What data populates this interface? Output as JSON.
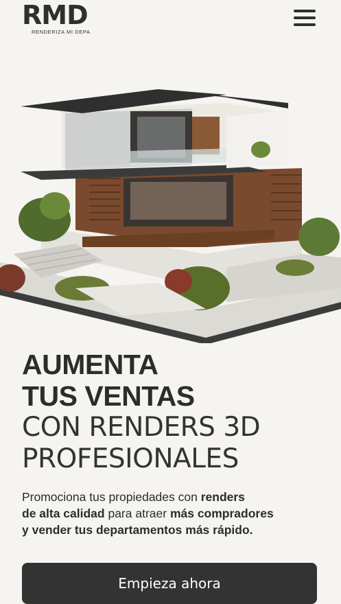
{
  "header": {
    "logo_mark": "RMD",
    "logo_tagline": "RENDERIZA MI DEPA",
    "menu_icon": "hamburger-menu-icon"
  },
  "hero": {
    "image_subject": "modern-house-render"
  },
  "headline": {
    "line1": "AUMENTA",
    "line2": "TUS VENTAS",
    "line3": "CON RENDERS 3D",
    "line4": "PROFESIONALES"
  },
  "description": {
    "p1": "Promociona tus propiedades con ",
    "b1": "renders",
    "b2": "de alta calidad",
    "p2": " para atraer ",
    "b3": "más compradores",
    "b4": "y vender tus departamentos más rápido."
  },
  "cta": {
    "label": "Empieza ahora"
  },
  "colors": {
    "background": "#f5f4f0",
    "text": "#2b2b2b",
    "button": "#333333",
    "button_text": "#ffffff"
  }
}
